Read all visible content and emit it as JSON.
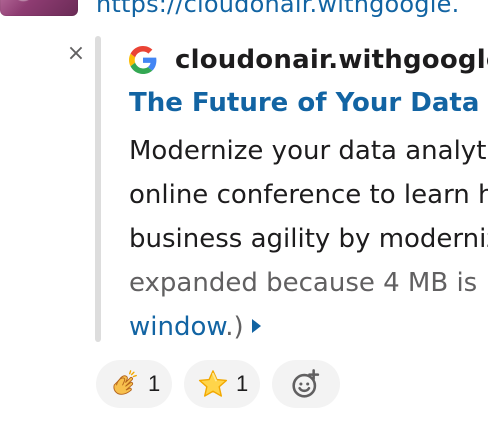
{
  "top_link": {
    "text": "https://cloudonair.withgoogle."
  },
  "unfurl": {
    "close_glyph": "×",
    "source": {
      "icon": "google-g-icon",
      "name": "cloudonair.withgoogle.c"
    },
    "title": "The Future of Your Data Wa",
    "description_lines": [
      "Modernize your data analyt",
      "online conference to learn h",
      "business agility by moderniz"
    ],
    "muted_line": "expanded because 4 MB is",
    "link_text": "window",
    "link_suffix": ".)"
  },
  "reactions": [
    {
      "emoji": "clapping-hands-icon",
      "count": "1"
    },
    {
      "emoji": "star-icon",
      "count": "1"
    }
  ],
  "add_reaction": {
    "icon": "add-reaction-icon"
  },
  "colors": {
    "link": "#1264a3",
    "text": "#1d1c1d",
    "muted": "#616061",
    "quote_bar": "#dddddd",
    "reaction_bg": "#f3f3f3"
  }
}
